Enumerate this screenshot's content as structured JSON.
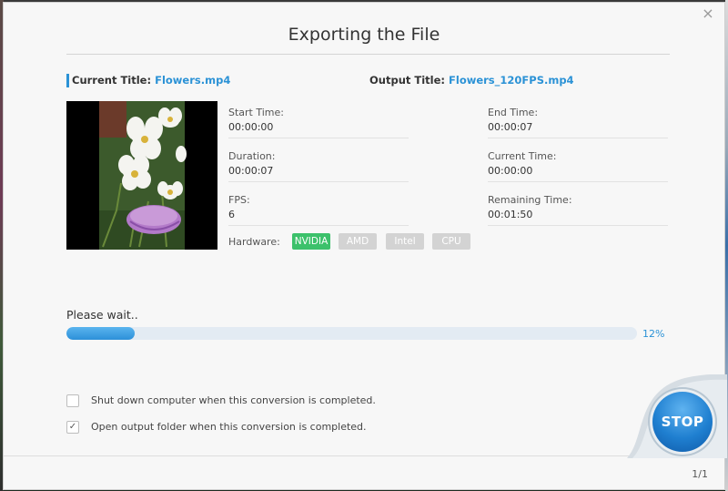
{
  "dialog": {
    "title": "Exporting the File",
    "close_symbol": "×"
  },
  "titles": {
    "current_label": "Current Title:",
    "current_value": "Flowers.mp4",
    "output_label": "Output Title:",
    "output_value": "Flowers_120FPS.mp4"
  },
  "info": {
    "start_time_label": "Start Time:",
    "start_time": "00:00:00",
    "end_time_label": "End Time:",
    "end_time": "00:00:07",
    "duration_label": "Duration:",
    "duration": "00:00:07",
    "current_time_label": "Current Time:",
    "current_time": "00:00:00",
    "fps_label": "FPS:",
    "fps": "6",
    "remaining_time_label": "Remaining Time:",
    "remaining_time": "00:01:50"
  },
  "hardware": {
    "label": "Hardware:",
    "options": [
      "NVIDIA",
      "AMD",
      "Intel",
      "CPU"
    ],
    "active": "NVIDIA"
  },
  "progress": {
    "status": "Please wait..",
    "percent": 12,
    "percent_label": "12%"
  },
  "options": {
    "shutdown": {
      "label": "Shut down computer when this conversion is completed.",
      "checked": false
    },
    "open_folder": {
      "label": "Open output folder when this conversion is completed.",
      "checked": true
    }
  },
  "stop_button": "STOP",
  "pagination": "1/1",
  "colors": {
    "accent": "#2b92d6",
    "hw_active": "#3cc16b",
    "hw_inactive": "#d3d3d3"
  }
}
